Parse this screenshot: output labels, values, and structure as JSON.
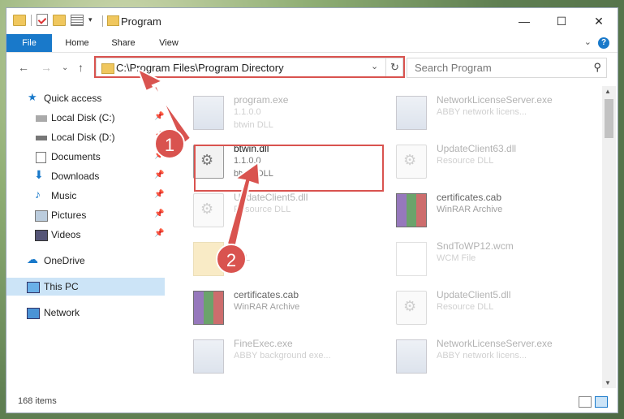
{
  "window": {
    "title": "Program"
  },
  "ribbon": {
    "tabs": [
      "File",
      "Home",
      "Share",
      "View"
    ]
  },
  "address": {
    "path": "C:\\Program Files\\Program Directory"
  },
  "search": {
    "placeholder": "Search Program"
  },
  "sidebar": {
    "items": [
      {
        "label": "Quick access"
      },
      {
        "label": "Local Disk (C:)"
      },
      {
        "label": "Local Disk (D:)"
      },
      {
        "label": "Documents"
      },
      {
        "label": "Downloads"
      },
      {
        "label": "Music"
      },
      {
        "label": "Pictures"
      },
      {
        "label": "Videos"
      },
      {
        "label": "OneDrive"
      },
      {
        "label": "This PC"
      },
      {
        "label": "Network"
      }
    ]
  },
  "files": {
    "left": [
      {
        "name": "program.exe",
        "sub": "1.1.0.0",
        "sub2": "btwin DLL"
      },
      {
        "name": "btwin.dll",
        "sub": "1.1.0.0",
        "sub2": "btwin DLL"
      },
      {
        "name": "UpdateClient5.dll",
        "sub": "Resource DLL",
        "sub2": ""
      },
      {
        "name": "",
        "sub": "DLL",
        "sub2": ""
      },
      {
        "name": "certificates.cab",
        "sub": "WinRAR Archive",
        "sub2": ""
      },
      {
        "name": "FineExec.exe",
        "sub": "ABBY background exe...",
        "sub2": ""
      }
    ],
    "right": [
      {
        "name": "NetworkLicenseServer.exe",
        "sub": "ABBY network licens...",
        "sub2": ""
      },
      {
        "name": "UpdateClient63.dll",
        "sub": "Resource DLL",
        "sub2": ""
      },
      {
        "name": "certificates.cab",
        "sub": "WinRAR Archive",
        "sub2": ""
      },
      {
        "name": "SndToWP12.wcm",
        "sub": "WCM File",
        "sub2": ""
      },
      {
        "name": "UpdateClient5.dll",
        "sub": "Resource DLL",
        "sub2": ""
      },
      {
        "name": "NetworkLicenseServer.exe",
        "sub": "ABBY network licens...",
        "sub2": ""
      }
    ]
  },
  "status": {
    "count": "168 items"
  },
  "badges": {
    "one": "1",
    "two": "2"
  },
  "colors": {
    "accent": "#1979ca",
    "highlight": "#d9534f"
  }
}
